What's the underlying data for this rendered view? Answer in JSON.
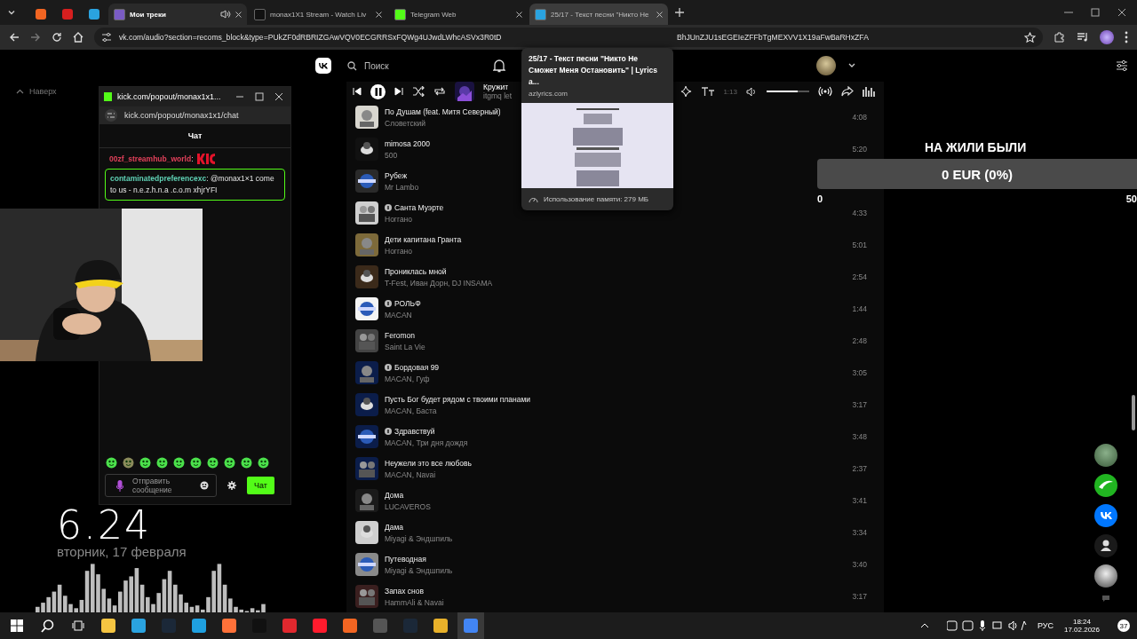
{
  "browser": {
    "tabs": [
      {
        "kind": "pinned",
        "selected": false,
        "hovered": false
      },
      {
        "kind": "pinned",
        "selected": false,
        "hovered": false
      },
      {
        "kind": "pinned",
        "selected": false,
        "hovered": false
      },
      {
        "kind": "page",
        "title": "Мои треки",
        "audio": true,
        "selected": true,
        "hovered": false
      },
      {
        "kind": "page",
        "title": "monax1X1 Stream - Watch Liv",
        "audio": false,
        "selected": false,
        "hovered": false
      },
      {
        "kind": "page",
        "title": "Telegram Web",
        "audio": false,
        "selected": false,
        "hovered": false
      },
      {
        "kind": "page",
        "title": "25/17 - Текст песни \"Никто Не",
        "audio": false,
        "selected": false,
        "hovered": true
      }
    ],
    "url_start": "vk.com/audio?section=recoms_block&type=PUkZF0dRBRIZGAwVQV0ECGRRSxFQWg4UJwdLWhcASVx3R0tD",
    "url_end": "BhJUnZJU1sEGEIeZFFbTgMEXVV1X19aFwBaRHxZFA"
  },
  "tab_tooltip": {
    "title": "25/17 - Текст песни \"Никто Не Сможет Меня Остановить\" | Lyrics a...",
    "domain": "azlyrics.com",
    "memory": "Использование памяти: 279 МБ"
  },
  "vk": {
    "search_placeholder": "Поиск",
    "back_to_top": "Наверх",
    "player": {
      "title": "Кружит",
      "artist": "itgmq let",
      "playing": true,
      "time": "1:13",
      "level": 0.72
    },
    "tracks": [
      {
        "title": "По Душам (feat. Митя Северный)",
        "artist": "Словетский",
        "duration": "4:08",
        "explicit": false
      },
      {
        "title": "mimosa 2000",
        "artist": "500",
        "duration": "5:20",
        "explicit": false
      },
      {
        "title": "Рубеж",
        "artist": "Mr Lambo",
        "explicit": false
      },
      {
        "title": "Санта Муэрте",
        "artist": "Ноггано",
        "duration": "4:33",
        "explicit": true
      },
      {
        "title": "Дети капитана Гранта",
        "artist": "Ноггано",
        "duration": "5:01",
        "explicit": false
      },
      {
        "title": "Прониклась мной",
        "artist": "T-Fest, Иван Дорн, DJ INSAMA",
        "duration": "2:54",
        "explicit": false
      },
      {
        "title": "РОЛЬФ",
        "artist": "MACAN",
        "duration": "1:44",
        "explicit": true
      },
      {
        "title": "Feromon",
        "artist": "Saint La Vie",
        "duration": "2:48",
        "explicit": false
      },
      {
        "title": "Бордовая 99",
        "artist": "MACAN, Гуф",
        "duration": "3:05",
        "explicit": true
      },
      {
        "title": "Пусть Бог будет рядом с твоими планами",
        "artist": "MACAN, Баста",
        "duration": "3:17",
        "explicit": false
      },
      {
        "title": "Здравствуй",
        "artist": "MACAN, Три дня дождя",
        "duration": "3:48",
        "explicit": true
      },
      {
        "title": "Неужели это все любовь",
        "artist": "MACAN, Navai",
        "duration": "2:37",
        "explicit": false
      },
      {
        "title": "Дома",
        "artist": "LUCAVEROS",
        "duration": "3:41",
        "explicit": false
      },
      {
        "title": "Дама",
        "artist": "Miyagi & Эндшпиль",
        "duration": "3:34",
        "explicit": false
      },
      {
        "title": "Путеводная",
        "artist": "Miyagi & Эндшпиль",
        "duration": "3:40",
        "explicit": false
      },
      {
        "title": "Запах снов",
        "artist": "HammAli & Navai",
        "duration": "3:17",
        "explicit": false
      }
    ]
  },
  "donation_goal": {
    "title": "НА ЖИЛИ БЫЛИ",
    "amount": "0 EUR (0%)",
    "level": 0,
    "min": "0",
    "max": "50"
  },
  "chat_window": {
    "title": "kick.com/popout/monax1x1...",
    "address": "kick.com/popout/monax1x1/chat",
    "header": "Чат",
    "messages": [
      {
        "user": "00zf_streamhub_world",
        "color": "#e0405a",
        "text": ":",
        "emote": true,
        "highlighted": false
      },
      {
        "user": "contaminatedpreferencexc",
        "color": "#5fd1b5",
        "text": ": @monax1×1 come to us - n.e.z.h.n.a .c.o.m xhjrYFI",
        "emote": false,
        "highlighted": true
      }
    ],
    "input_placeholder": "Отправить сообщение",
    "send_label": "Чат"
  },
  "desktop_clock": {
    "time": "6.24",
    "date": "вторник, 17 февраля"
  },
  "taskbar": {
    "apps": [
      {
        "active": false
      },
      {
        "active": false
      },
      {
        "active": false
      },
      {
        "active": false
      },
      {
        "active": false
      },
      {
        "active": false
      },
      {
        "active": false
      },
      {
        "active": false
      },
      {
        "active": false
      },
      {
        "active": false
      },
      {
        "active": false
      },
      {
        "active": false
      },
      {
        "active": true
      }
    ],
    "language": "РУС",
    "time": "18:24",
    "date": "17.02.2026",
    "notifications": "37"
  }
}
